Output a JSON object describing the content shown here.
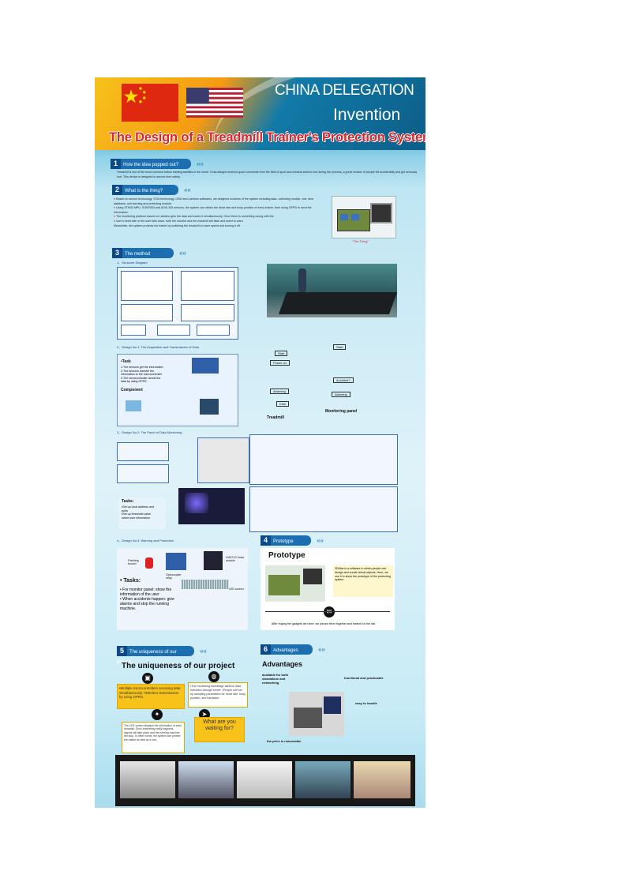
{
  "header": {
    "line1": "CHINA DELEGATION",
    "line2": "Invention",
    "title": "The Design of a Treadmill Trainer's Protection System"
  },
  "s1": {
    "num": "1",
    "label": "How the idea popped out?",
    "text": "Treadmill is one of the most common indoor training facilities in the world. It has always received good comments from the field of sport and medical science but during the process, a great number of people fell accidentally and get seriously hurt. This device is designed to secure their safety."
  },
  "s2": {
    "num": "2",
    "label": "What is the thing?",
    "bullets": [
      "Based on sensor technology, SCM technology, GSM and Labview softwares, we designed modules of the system including:data- collecting module, real -time database, and warning and protecting module.",
      "Using STM32 MPU, SOM7003 and ADXL345 sensors, the system can obtain the heart rate and body position of every trainer, then using GPRS to send the information.",
      "The monitoring platform based on Labview gets the data and saves it simultaneously. Once there is something wrong with the",
      "user's heart rate or the user falls down, both the monitor and the treadmill will flash and tweet to warn.",
      "Meanwhile, the system protects the trainer by switching the treadmill to lower speed and turning it off."
    ],
    "caption": "\"The Thing\""
  },
  "s3": {
    "num": "3",
    "label": "The method",
    "d1": "1、Structure Diagram",
    "d2": "2、Design No.1: The Acquisition and Transmission of Data",
    "task_head": "•Task",
    "task_lines": [
      "1.The sensors get the information",
      "2.The sensors transfer the",
      "information to the microcontroller",
      "3.The microcontroller sends the",
      "data by using GPRS"
    ],
    "component": "Component",
    "treadmill": "Treadmill",
    "monitoring": "Monitoring panel",
    "flow": {
      "start": "Start",
      "power": "Power on",
      "alarming": "Alarming",
      "end": "END",
      "accident": "Accident?"
    },
    "d3": "3、Design No.2: The Panel of Data Monitoring",
    "tasks2_head": "Tasks:",
    "tasks2": [
      "•Set up local address and",
      "ports",
      "•Set up threshold value",
      "•store user information"
    ],
    "d4": "4、Design No.3: Warning and Protection",
    "flashing": "Flashing buzzer",
    "optocoupler": "Optocoupler relay",
    "lmd": "LMD713 Voice module",
    "led": "LED screen",
    "tasks3_head": "• Tasks:",
    "tasks3": [
      "• For monitor panel: show the information of the user",
      "• When accidents happen: give alarms and stop the running machine."
    ]
  },
  "s4": {
    "num": "4",
    "label": "Prototype",
    "heading": "Prototype",
    "desc": "3DMax is a software in which people can design and create virtual objects. Here, we use it to show the prototype of the protecting system.",
    "bottom": "After buying the gadgets we need, we pieced them together and tested it in the lab."
  },
  "s5": {
    "num": "5",
    "label": "The uniqueness of our project",
    "heading": "The uniqueness of our project",
    "b1": "•Multiple microcontrollers receiving data simultaneously. •Wireless transmission by using GPRS.",
    "b2": "•The monitoring backstage achieve data transition through server. •People can set up sampling parameters for heart rate, body position, and hardware.",
    "b3": "The LED screen displays the information of each treadmill. Once something really happens, alarms will take place and the running machine will stop. In other words, the system can protect the trainer as best as it can.",
    "b4": "What are you waiting for?"
  },
  "s6": {
    "num": "6",
    "label": "Advantages",
    "heading": "Advantages",
    "a1": "available for both standalone and networking",
    "a2": "functional and practicable",
    "a3": "easy to handle",
    "a4": "the price is reasonable"
  },
  "colors": {
    "red": "#d7262c",
    "blue": "#1b6fb1",
    "yellow": "#f7c21a"
  }
}
